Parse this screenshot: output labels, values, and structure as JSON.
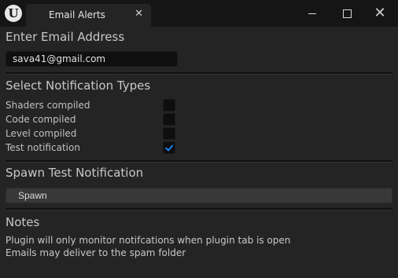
{
  "window": {
    "logo_icon": "unreal-engine-logo-icon",
    "tab_title": "Email Alerts",
    "tab_close_icon": "close-icon",
    "minimize_icon": "minimize-icon",
    "maximize_icon": "maximize-icon",
    "close_icon": "close-icon"
  },
  "email": {
    "heading": "Enter Email Address",
    "value": "sava41@gmail.com"
  },
  "notifications": {
    "heading": "Select Notification Types",
    "items": [
      {
        "label": "Shaders compiled",
        "checked": false
      },
      {
        "label": "Code compiled",
        "checked": false
      },
      {
        "label": "Level compiled",
        "checked": false
      },
      {
        "label": "Test notification",
        "checked": true
      }
    ],
    "check_icon": "checkmark-icon",
    "accent_color": "#1a8cff"
  },
  "spawn": {
    "heading": "Spawn Test Notification",
    "button_label": "Spawn"
  },
  "notes": {
    "heading": "Notes",
    "lines": [
      "Plugin will only monitor notifcations when plugin tab is open",
      "Emails may deliver to the spam folder"
    ]
  }
}
